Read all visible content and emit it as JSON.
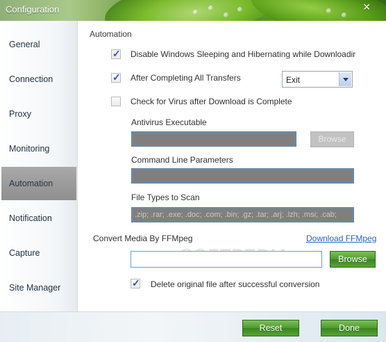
{
  "window": {
    "title": "Configuration",
    "close_glyph": "✕"
  },
  "sidebar": {
    "items": [
      {
        "label": "General"
      },
      {
        "label": "Connection"
      },
      {
        "label": "Proxy"
      },
      {
        "label": "Monitoring"
      },
      {
        "label": "Automation",
        "active": true
      },
      {
        "label": "Notification"
      },
      {
        "label": "Capture"
      },
      {
        "label": "Site Manager"
      }
    ]
  },
  "automation": {
    "section_title": "Automation",
    "disable_sleep": {
      "label": "Disable Windows Sleeping and Hibernating while Downloadir",
      "checked": true
    },
    "after_transfers": {
      "label": "After Completing All Transfers",
      "checked": true,
      "action": "Exit"
    },
    "virus_check": {
      "label": "Check for Virus after Download is Complete",
      "checked": false
    },
    "antivirus": {
      "label": "Antivirus Executable",
      "value": "",
      "browse_label": "Browse"
    },
    "cmdline": {
      "label": "Command Line Parameters",
      "value": ""
    },
    "filetypes": {
      "label": "File Types to Scan",
      "value": ".zip; .rar; .exe; .doc; .com; .bin; .gz; .tar; .arj; .lzh; .msi; .cab;"
    }
  },
  "ffmpeg": {
    "label": "Convert Media By FFMpeg",
    "download_link": "Download FFMpeg",
    "path_value": "",
    "browse_label": "Browse",
    "delete_original": {
      "label": "Delete original file after successful conversion",
      "checked": true
    }
  },
  "footer": {
    "reset_label": "Reset",
    "done_label": "Done"
  },
  "watermark": "SOFTPEDIA",
  "colors": {
    "accent_green": "#4e9a2e",
    "link_blue": "#2962b8",
    "active_nav": "#8f8f8f"
  }
}
